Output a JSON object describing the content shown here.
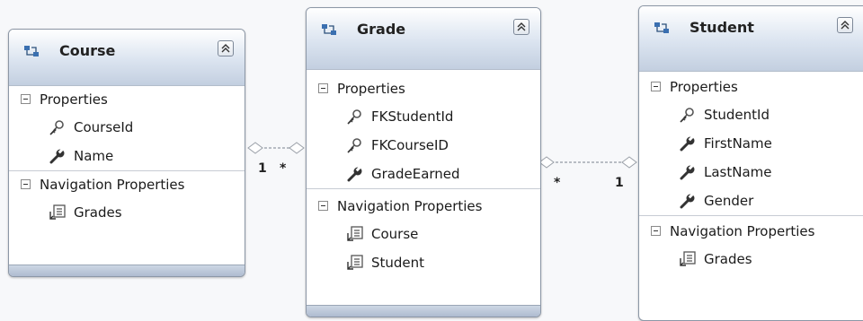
{
  "entities": {
    "course": {
      "title": "Course",
      "properties_label": "Properties",
      "properties": [
        "CourseId",
        "Name"
      ],
      "navigation_label": "Navigation Properties",
      "navigation": [
        "Grades"
      ]
    },
    "grade": {
      "title": "Grade",
      "properties_label": "Properties",
      "properties": [
        "FKStudentId",
        "FKCourseID",
        "GradeEarned"
      ],
      "navigation_label": "Navigation Properties",
      "navigation": [
        "Course",
        "Student"
      ]
    },
    "student": {
      "title": "Student",
      "properties_label": "Properties",
      "properties": [
        "StudentId",
        "FirstName",
        "LastName",
        "Gender"
      ],
      "navigation_label": "Navigation Properties",
      "navigation": [
        "Grades"
      ]
    }
  },
  "associations": {
    "course_grade": {
      "left_multiplicity": "1",
      "right_multiplicity": "*"
    },
    "grade_student": {
      "left_multiplicity": "*",
      "right_multiplicity": "1"
    }
  },
  "icons": {
    "entity": "entity-icon",
    "key": "key-icon",
    "property": "wrench-icon",
    "navigation": "navigation-property-icon",
    "collapse": "collapse-chevrons-icon"
  },
  "colors": {
    "header_gradient_top": "#ffffff",
    "header_gradient_bottom": "#c3cfe0",
    "border": "#8c97a6",
    "connector": "#9aa0a8"
  }
}
